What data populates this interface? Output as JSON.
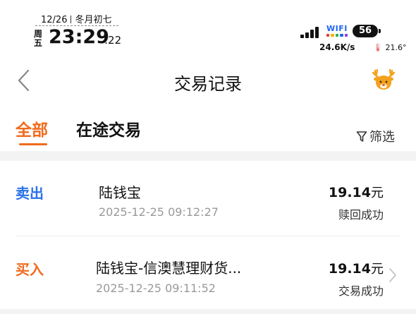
{
  "status_bar": {
    "date": "12/26",
    "lunar": "冬月初七",
    "weekday": "周五",
    "time": "23:29",
    "seconds": ":22",
    "wifi_label": "WIFI",
    "battery": "56",
    "net_speed": "24.6K/s",
    "temperature": "21.6°"
  },
  "navbar": {
    "title": "交易记录",
    "back_icon": "chevron-left-icon",
    "mascot_icon": "deer-mascot-icon"
  },
  "tabs": [
    {
      "label": "全部",
      "active": true
    },
    {
      "label": "在途交易",
      "active": false
    }
  ],
  "filter": {
    "label": "筛选",
    "icon": "funnel-icon"
  },
  "transactions": [
    {
      "type": "卖出",
      "type_color": "#2a73e8",
      "name": "陆钱宝",
      "time": "2025-12-25 09:12:27",
      "amount": "19.14",
      "unit": "元",
      "status": "赎回成功",
      "has_chevron": false
    },
    {
      "type": "买入",
      "type_color": "#f06a1c",
      "name": "陆钱宝-信澳慧理财货...",
      "time": "2025-12-25 09:11:52",
      "amount": "19.14",
      "unit": "元",
      "status": "交易成功",
      "has_chevron": true
    }
  ],
  "colors": {
    "accent": "#f06a1c",
    "sell_blue": "#2a73e8",
    "muted_text": "#999999"
  }
}
